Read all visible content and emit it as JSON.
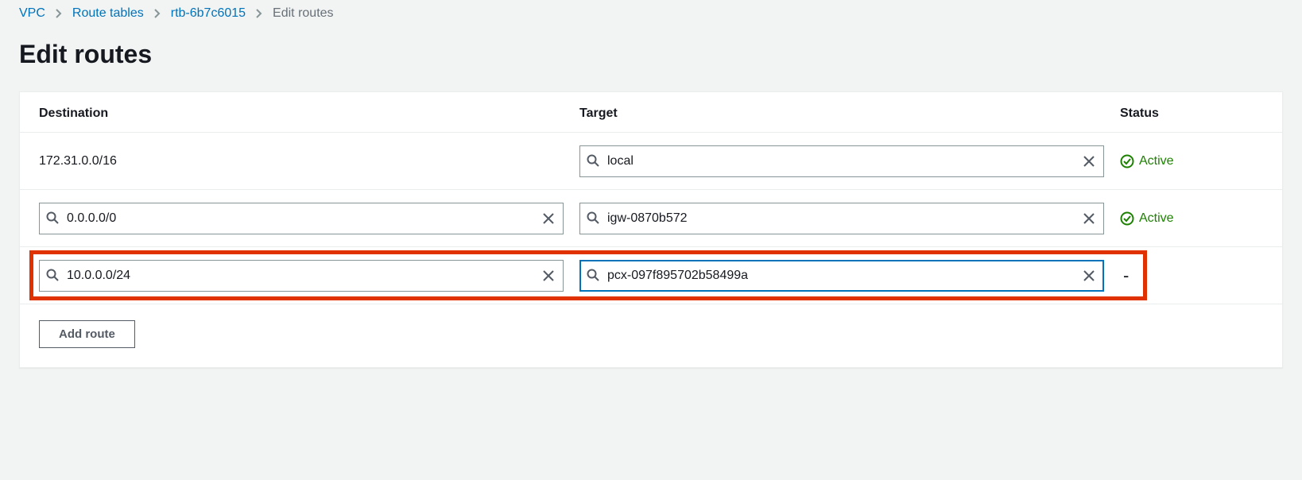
{
  "breadcrumb": {
    "items": [
      {
        "label": "VPC"
      },
      {
        "label": "Route tables"
      },
      {
        "label": "rtb-6b7c6015"
      }
    ],
    "current": "Edit routes"
  },
  "page_title": "Edit routes",
  "columns": {
    "destination": "Destination",
    "target": "Target",
    "status": "Status"
  },
  "routes": [
    {
      "destination_static": "172.31.0.0/16",
      "destination_editable": false,
      "target_value": "local",
      "status": "Active",
      "highlighted": false,
      "target_focused": false
    },
    {
      "destination_value": "0.0.0.0/0",
      "destination_editable": true,
      "target_value": "igw-0870b572",
      "status": "Active",
      "highlighted": false,
      "target_focused": false
    },
    {
      "destination_value": "10.0.0.0/24",
      "destination_editable": true,
      "target_value": "pcx-097f895702b58499a",
      "status": "-",
      "highlighted": true,
      "target_focused": true
    }
  ],
  "add_route_label": "Add route"
}
